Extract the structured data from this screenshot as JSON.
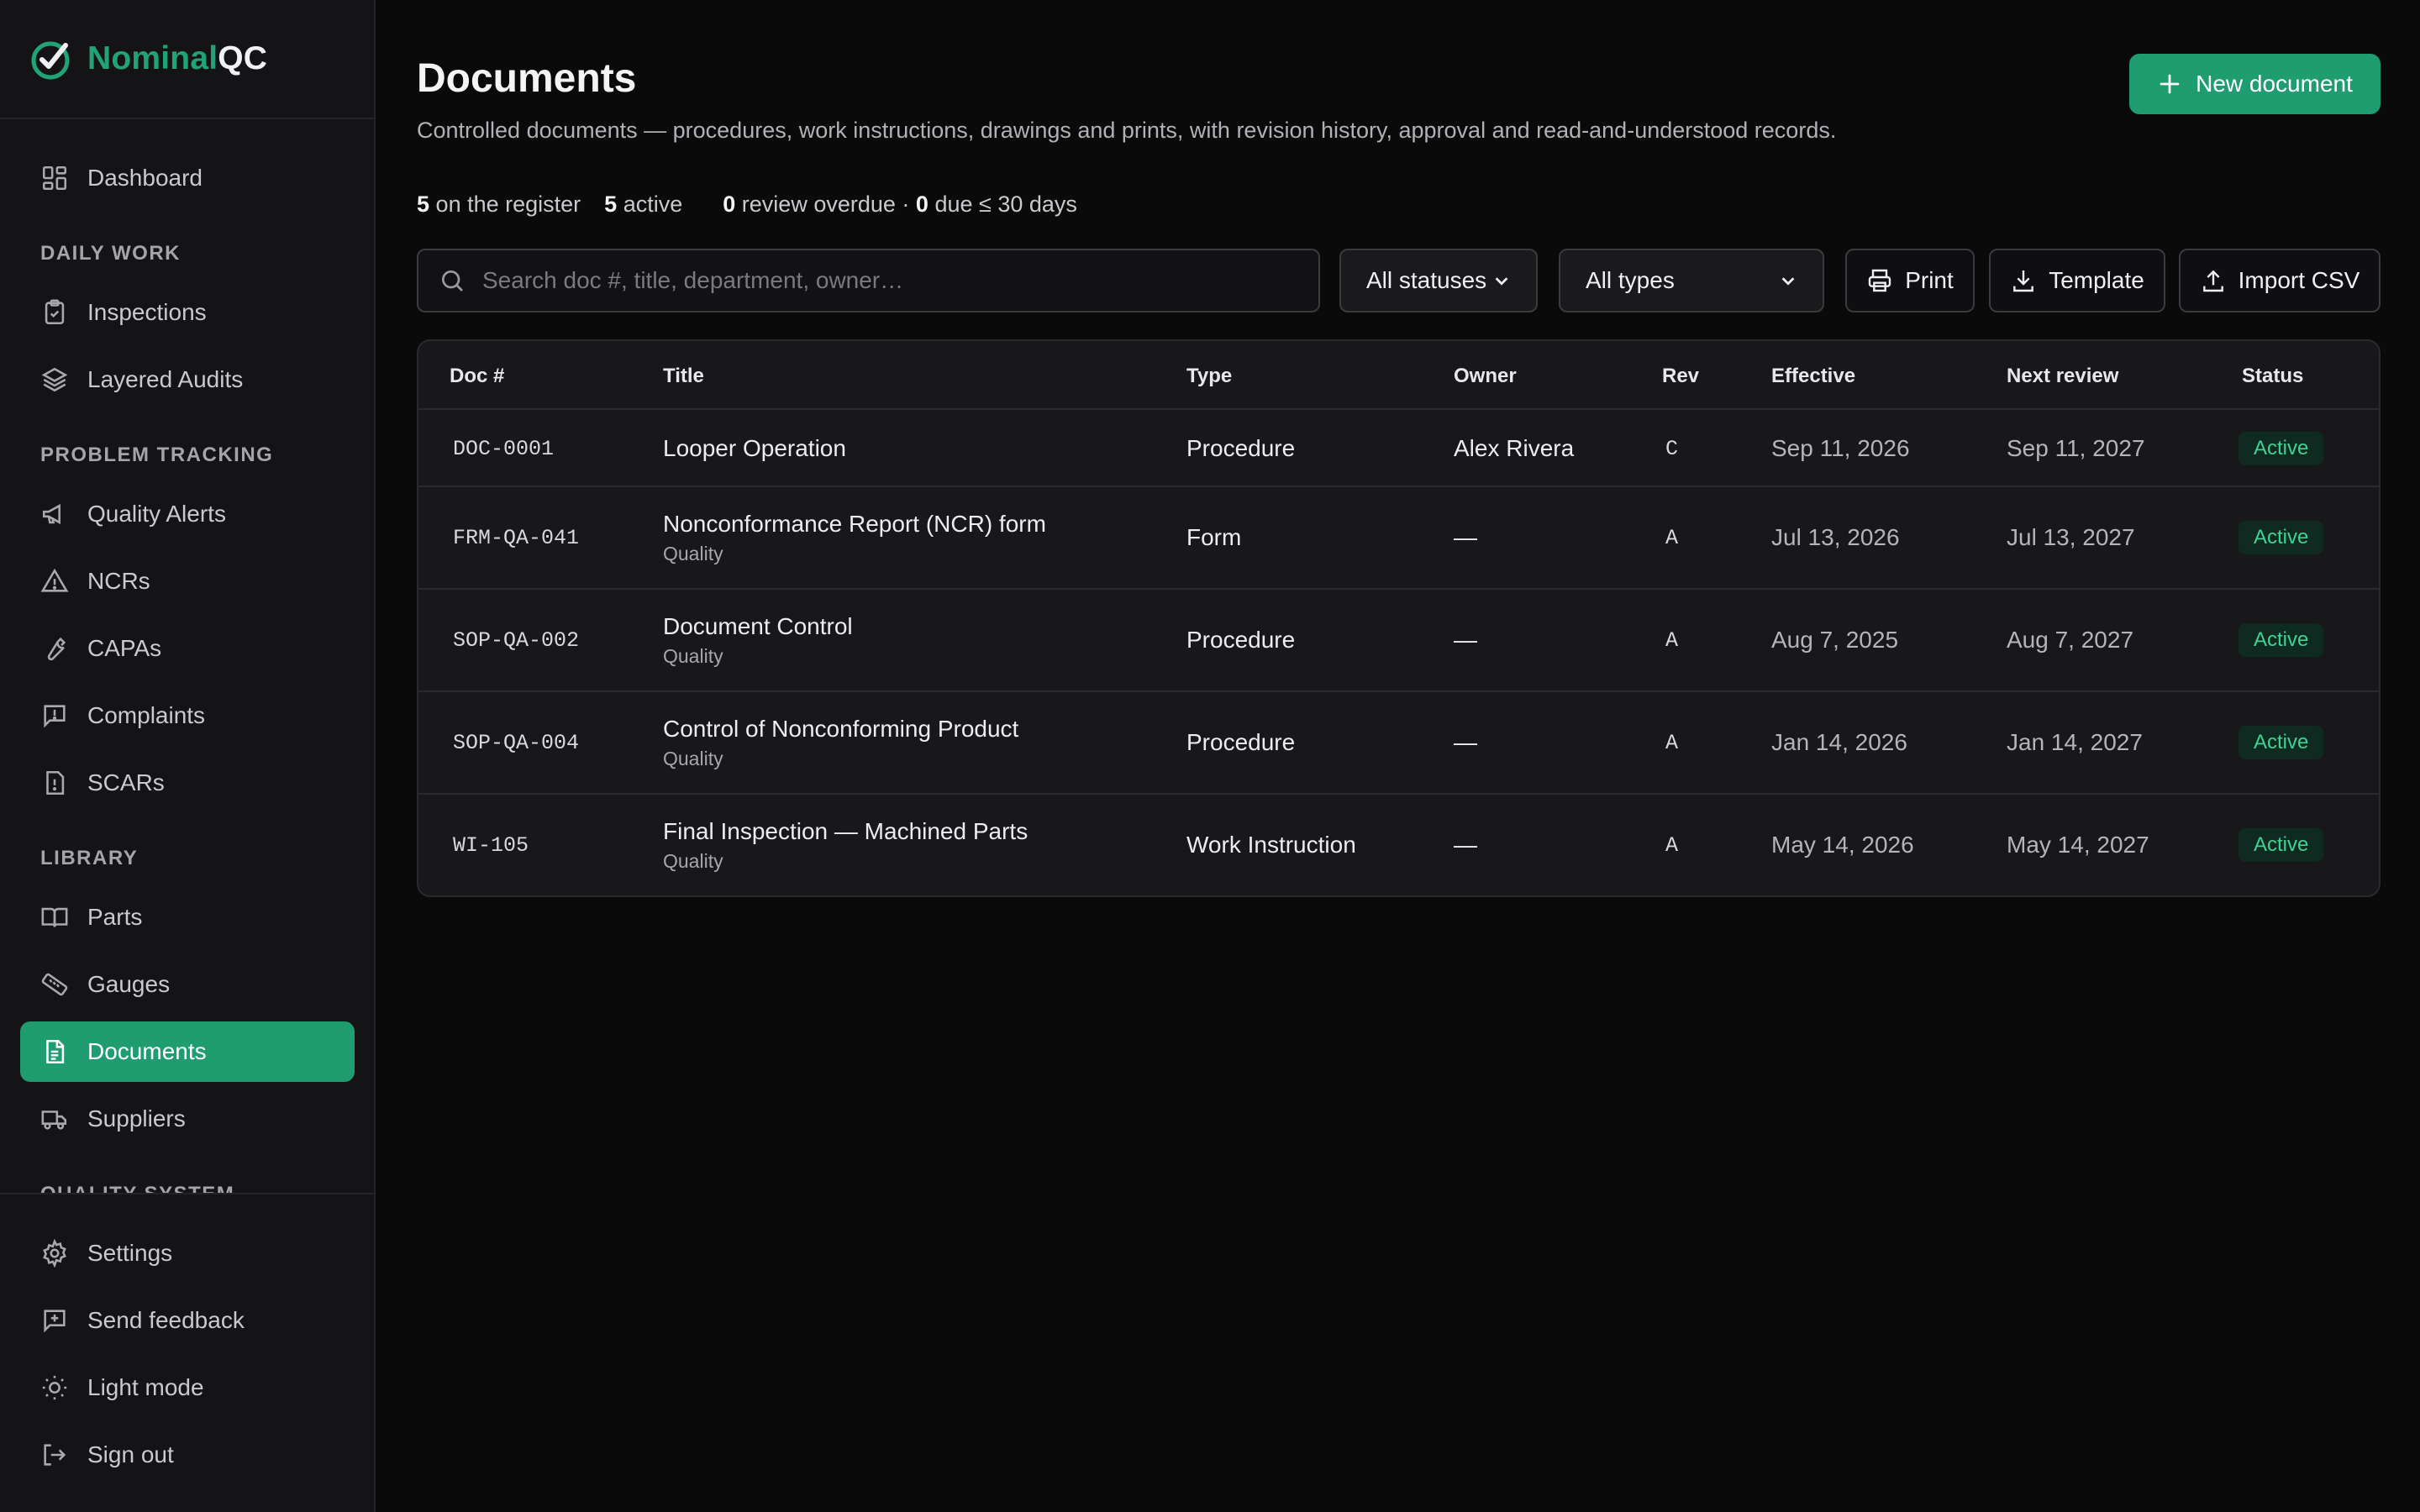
{
  "app": {
    "brand_a": "Nominal",
    "brand_b": "QC"
  },
  "sidebar": {
    "dashboard": "Dashboard",
    "sections": {
      "daily_work": "DAILY WORK",
      "problem_tracking": "PROBLEM TRACKING",
      "library": "LIBRARY",
      "quality_system": "QUALITY SYSTEM"
    },
    "items": {
      "inspections": "Inspections",
      "layered_audits": "Layered Audits",
      "quality_alerts": "Quality Alerts",
      "ncrs": "NCRs",
      "capas": "CAPAs",
      "complaints": "Complaints",
      "scars": "SCARs",
      "parts": "Parts",
      "gauges": "Gauges",
      "documents": "Documents",
      "suppliers": "Suppliers"
    },
    "bottom": {
      "settings": "Settings",
      "send_feedback": "Send feedback",
      "light_mode": "Light mode",
      "sign_out": "Sign out"
    },
    "active_item": "Documents",
    "accent_color": "#1f9c70"
  },
  "header": {
    "title": "Documents",
    "description": "Controlled documents — procedures, work instructions, drawings and prints, with revision history, approval and read-and-understood records.",
    "new_button": "New document"
  },
  "stats": {
    "register_count": "5",
    "register_label": "on the register",
    "active_count": "5",
    "active_label": "active",
    "overdue_count": "0",
    "overdue_label": "review overdue",
    "separator": "·",
    "due_count": "0",
    "due_label": "due ≤ 30 days"
  },
  "filters": {
    "search_placeholder": "Search doc #, title, department, owner…",
    "status_selected": "All statuses",
    "type_selected": "All types"
  },
  "toolbar": {
    "print": "Print",
    "template": "Template",
    "import_csv": "Import CSV"
  },
  "table": {
    "columns": [
      "Doc #",
      "Title",
      "Type",
      "Owner",
      "Rev",
      "Effective",
      "Next review",
      "Status"
    ],
    "rows": [
      {
        "doc": "DOC-0001",
        "title": "Looper Operation",
        "dept": "",
        "type": "Procedure",
        "owner": "Alex Rivera",
        "rev": "C",
        "effective": "Sep 11, 2026",
        "next_review": "Sep 11, 2027",
        "status": "Active"
      },
      {
        "doc": "FRM-QA-041",
        "title": "Nonconformance Report (NCR) form",
        "dept": "Quality",
        "type": "Form",
        "owner": "—",
        "rev": "A",
        "effective": "Jul 13, 2026",
        "next_review": "Jul 13, 2027",
        "status": "Active"
      },
      {
        "doc": "SOP-QA-002",
        "title": "Document Control",
        "dept": "Quality",
        "type": "Procedure",
        "owner": "—",
        "rev": "A",
        "effective": "Aug 7, 2025",
        "next_review": "Aug 7, 2027",
        "status": "Active"
      },
      {
        "doc": "SOP-QA-004",
        "title": "Control of Nonconforming Product",
        "dept": "Quality",
        "type": "Procedure",
        "owner": "—",
        "rev": "A",
        "effective": "Jan 14, 2026",
        "next_review": "Jan 14, 2027",
        "status": "Active"
      },
      {
        "doc": "WI-105",
        "title": "Final Inspection — Machined Parts",
        "dept": "Quality",
        "type": "Work Instruction",
        "owner": "—",
        "rev": "A",
        "effective": "May 14, 2026",
        "next_review": "May 14, 2027",
        "status": "Active"
      }
    ]
  }
}
